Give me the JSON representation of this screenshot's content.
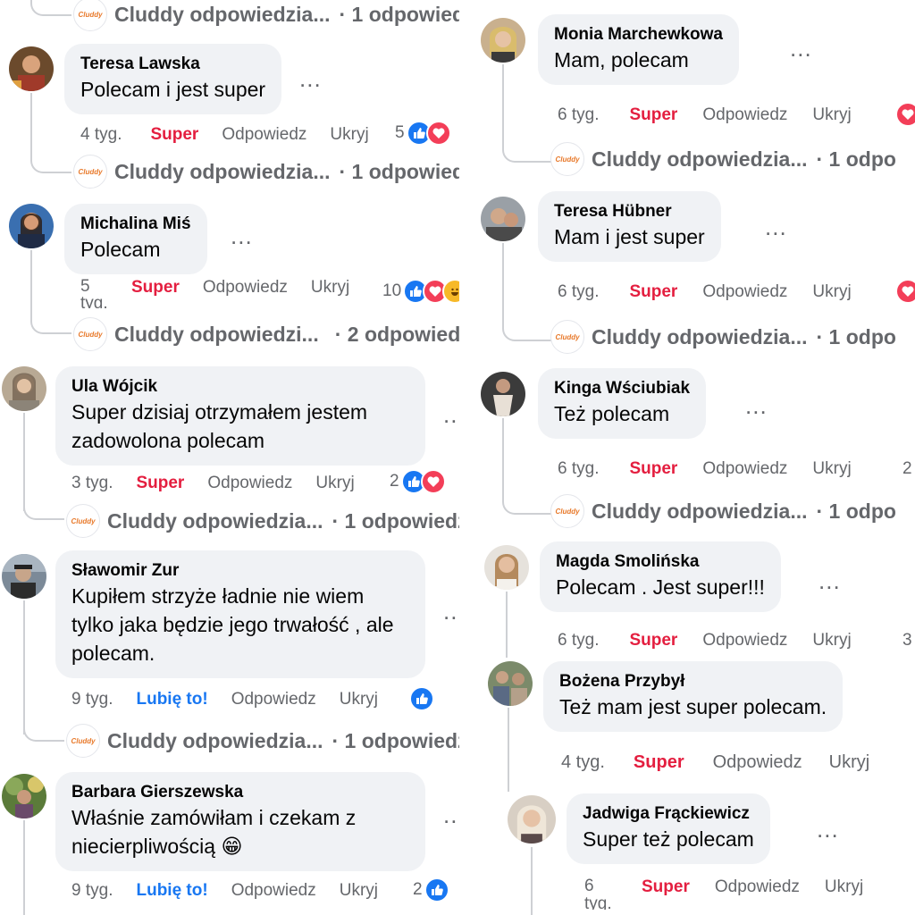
{
  "brand": {
    "name": "Cluddy",
    "color": "#e8792a"
  },
  "colors": {
    "super": "#e41e3f",
    "like": "#1877f2",
    "love": "#f33e58",
    "haha": "#f7b928",
    "muted": "#65676b",
    "bubble": "#f0f2f5"
  },
  "actions": {
    "reply": "Odpowiedz",
    "hide": "Ukryj",
    "more": "..."
  },
  "left": [
    {
      "reply_label": "Cluddy odpowiedzia...",
      "reply_count": "· 1 odpowied"
    },
    {
      "author": "Teresa Lawska",
      "text": "Polecam i jest super",
      "time": "4 tyg.",
      "reaction": "Super",
      "count": "5",
      "reply_label": "Cluddy odpowiedzia...",
      "reply_count": "· 1 odpowied"
    },
    {
      "author": "Michalina Miś",
      "text": "Polecam",
      "time": "5 tyg.",
      "reaction": "Super",
      "count": "10",
      "reply_label": "Cluddy odpowiedzi...",
      "reply_count": "· 2 odpowied"
    },
    {
      "author": "Ula Wójcik",
      "text": "Super dzisiaj otrzymałem jestem zadowolona polecam",
      "time": "3 tyg.",
      "reaction": "Super",
      "count": "2",
      "reply_label": "Cluddy odpowiedzia...",
      "reply_count": "· 1 odpowiedzi"
    },
    {
      "author": "Sławomir Zur",
      "text": "Kupiłem strzyże ładnie nie wiem tylko jaka będzie jego trwałość , ale polecam.",
      "time": "9 tyg.",
      "reaction": "Lubię to!",
      "count": "",
      "reply_label": "Cluddy odpowiedzia...",
      "reply_count": "· 1 odpowiedzi"
    },
    {
      "author": "Barbara Gierszewska",
      "text": "Właśnie zamówiłam i czekam z niecierpliwością 😁",
      "time": "9 tyg.",
      "reaction": "Lubię to!",
      "count": "2"
    }
  ],
  "right": [
    {
      "author": "Monia Marchewkowa",
      "text": "Mam, polecam",
      "time": "6 tyg.",
      "reaction": "Super",
      "reply_label": "Cluddy odpowiedzia...",
      "reply_count": "· 1 odpo"
    },
    {
      "author": "Teresa Hübner",
      "text": "Mam i jest super",
      "time": "6 tyg.",
      "reaction": "Super",
      "reply_label": "Cluddy odpowiedzia...",
      "reply_count": "· 1 odpo"
    },
    {
      "author": "Kinga Wściubiak",
      "text": "Też polecam",
      "time": "6 tyg.",
      "reaction": "Super",
      "count": "2",
      "reply_label": "Cluddy odpowiedzia...",
      "reply_count": "· 1 odpo"
    },
    {
      "author": "Magda Smolińska",
      "text": "Polecam . Jest super!!!",
      "time": "6 tyg.",
      "reaction": "Super",
      "count": "3"
    },
    {
      "author": "Bożena Przybył",
      "text": "Też mam jest super polecam.",
      "time": "4 tyg.",
      "reaction": "Super"
    },
    {
      "author": "Jadwiga Frąckiewicz",
      "text": "Super też polecam",
      "time": "6 tyg.",
      "reaction": "Super"
    }
  ]
}
